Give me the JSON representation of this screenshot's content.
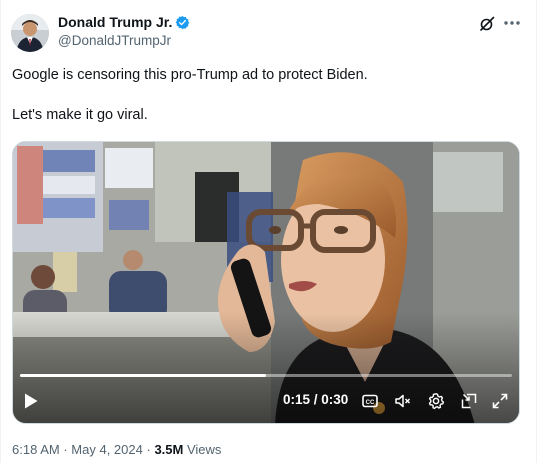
{
  "author": {
    "display_name": "Donald Trump Jr.",
    "handle": "@DonaldJTrumpJr",
    "verified": true
  },
  "tweet": {
    "lines": [
      "Google is censoring this pro-Trump ad to protect Biden.",
      "Let's make it go viral."
    ]
  },
  "video": {
    "current_time": "0:15",
    "duration": "0:30",
    "time_display": "0:15 / 0:30",
    "progress_fraction": 0.5
  },
  "meta": {
    "time": "6:18 AM",
    "date": "May 4, 2024",
    "separator": "·",
    "views_count": "3.5M",
    "views_label": "Views"
  },
  "icons": {
    "grok": "grok-icon",
    "more": "more-icon",
    "play": "play-icon",
    "captions": "captions-icon",
    "volume": "muted-volume-icon",
    "settings": "settings-icon",
    "pip": "picture-in-picture-icon",
    "fullscreen": "fullscreen-icon"
  },
  "colors": {
    "verified": "#1d9bf0",
    "text_primary": "#0f1419",
    "text_secondary": "#536471"
  }
}
